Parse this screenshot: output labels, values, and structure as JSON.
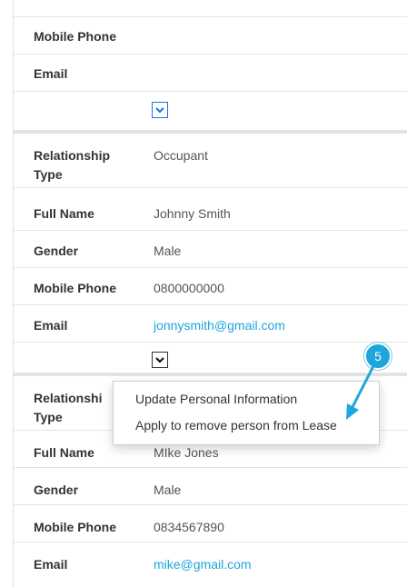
{
  "person_1": {
    "mobile_label": "Mobile Phone",
    "email_label": "Email"
  },
  "person_2": {
    "relationship_label_line1": "Relationship",
    "relationship_label_line2": "Type",
    "relationship_value": "Occupant",
    "full_name_label": "Full Name",
    "full_name_value": "Johnny Smith",
    "gender_label": "Gender",
    "gender_value": "Male",
    "mobile_label": "Mobile Phone",
    "mobile_value": "0800000000",
    "email_label": "Email",
    "email_value": "jonnysmith@gmail.com"
  },
  "person_3": {
    "relationship_label_line1": "Relationshi",
    "relationship_label_line2": "Type",
    "full_name_label": "Full Name",
    "full_name_value": "MIke Jones",
    "gender_label": "Gender",
    "gender_value": "Male",
    "mobile_label": "Mobile Phone",
    "mobile_value": "0834567890",
    "email_label": "Email",
    "email_value": "mike@gmail.com"
  },
  "context_menu": {
    "items": [
      "Update Personal Information",
      "Apply to remove person from Lease"
    ]
  },
  "annotation": {
    "step_number": "5",
    "color": "#1ea5dc"
  },
  "colors": {
    "link": "#1ea5dc",
    "toggle_active_border": "#1a73e8",
    "divider": "#e3e3e3"
  },
  "icons": [
    "chevron-down-icon"
  ]
}
